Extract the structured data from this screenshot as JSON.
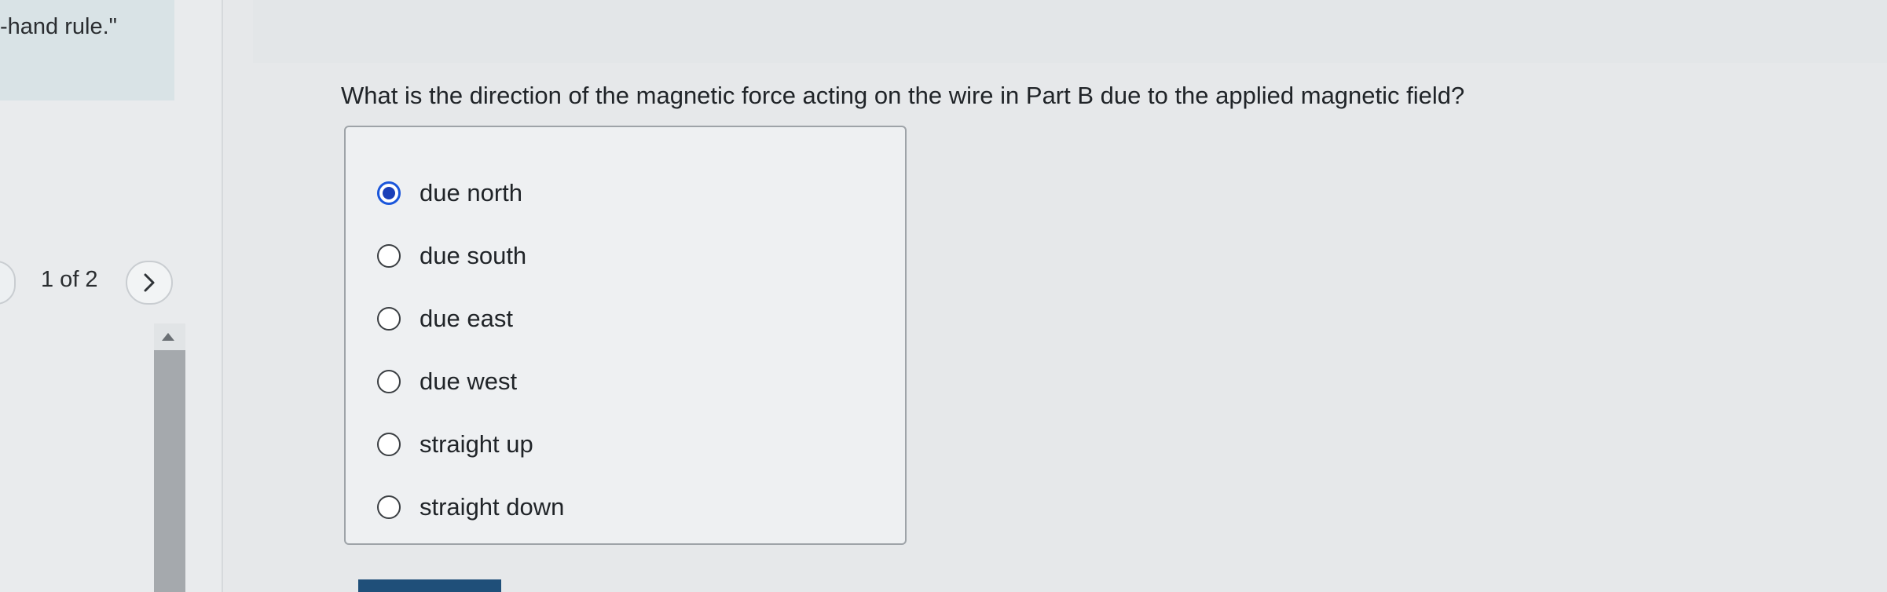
{
  "sidebar": {
    "hint_text": "-hand rule.\"",
    "pager_text": "1 of 2",
    "next_icon": "chevron-right-icon"
  },
  "main": {
    "question": "What is the direction of the magnetic force acting on the wire in Part B due to the applied magnetic field?",
    "options": [
      {
        "label": "due north",
        "selected": true
      },
      {
        "label": "due south",
        "selected": false
      },
      {
        "label": "due east",
        "selected": false
      },
      {
        "label": "due west",
        "selected": false
      },
      {
        "label": "straight up",
        "selected": false
      },
      {
        "label": "straight down",
        "selected": false
      }
    ]
  },
  "colors": {
    "accent": "#1a56db",
    "submit_button": "#1f4f79"
  }
}
